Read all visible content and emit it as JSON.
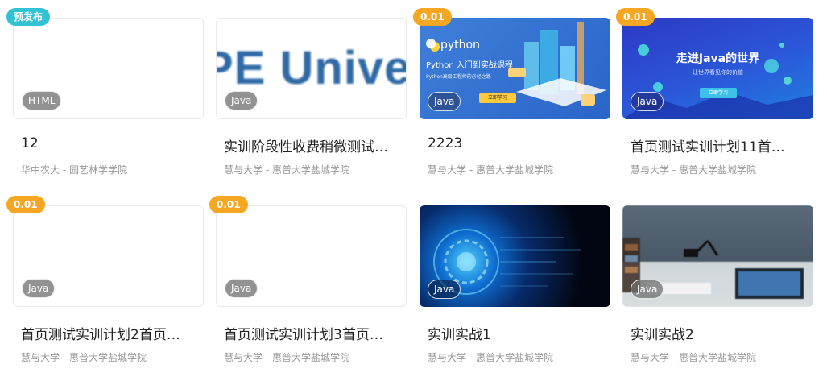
{
  "cards": [
    {
      "badge": "预发布",
      "badge_type": "pre",
      "tag": "HTML",
      "title": "12",
      "sub": "华中农大 - 园艺林学学院",
      "thumb": "blank"
    },
    {
      "badge": "",
      "badge_type": "",
      "tag": "Java",
      "title": "实训阶段性收费稍微测试…",
      "sub": "慧与大学 - 惠普大学盐城学院",
      "thumb": "university",
      "thumb_text": "PE Univer"
    },
    {
      "badge": "0.01",
      "badge_type": "price",
      "tag": "Java",
      "title": "2223",
      "sub": "慧与大学 - 惠普大学盐城学院",
      "thumb": "python",
      "thumb_lines": [
        "python",
        "Python 入门到实战课程",
        "Python高级工程师的必经之路",
        "立即学习"
      ]
    },
    {
      "badge": "0.01",
      "badge_type": "price",
      "tag": "Java",
      "title": "首页测试实训计划11首…",
      "sub": "慧与大学 - 惠普大学盐城学院",
      "thumb": "java",
      "thumb_lines": [
        "走进Java的世界",
        "让世界看见你的价值",
        "立即学习"
      ]
    },
    {
      "badge": "0.01",
      "badge_type": "price",
      "tag": "Java",
      "title": "首页测试实训计划2首页…",
      "sub": "慧与大学 - 惠普大学盐城学院",
      "thumb": "blank"
    },
    {
      "badge": "0.01",
      "badge_type": "price",
      "tag": "Java",
      "title": "首页测试实训计划3首页…",
      "sub": "慧与大学 - 惠普大学盐城学院",
      "thumb": "blank"
    },
    {
      "badge": "",
      "badge_type": "",
      "tag": "Java",
      "title": "实训实战1",
      "sub": "慧与大学 - 惠普大学盐城学院",
      "thumb": "tech"
    },
    {
      "badge": "",
      "badge_type": "",
      "tag": "Java",
      "title": "实训实战2",
      "sub": "慧与大学 - 惠普大学盐城学院",
      "thumb": "room"
    }
  ]
}
